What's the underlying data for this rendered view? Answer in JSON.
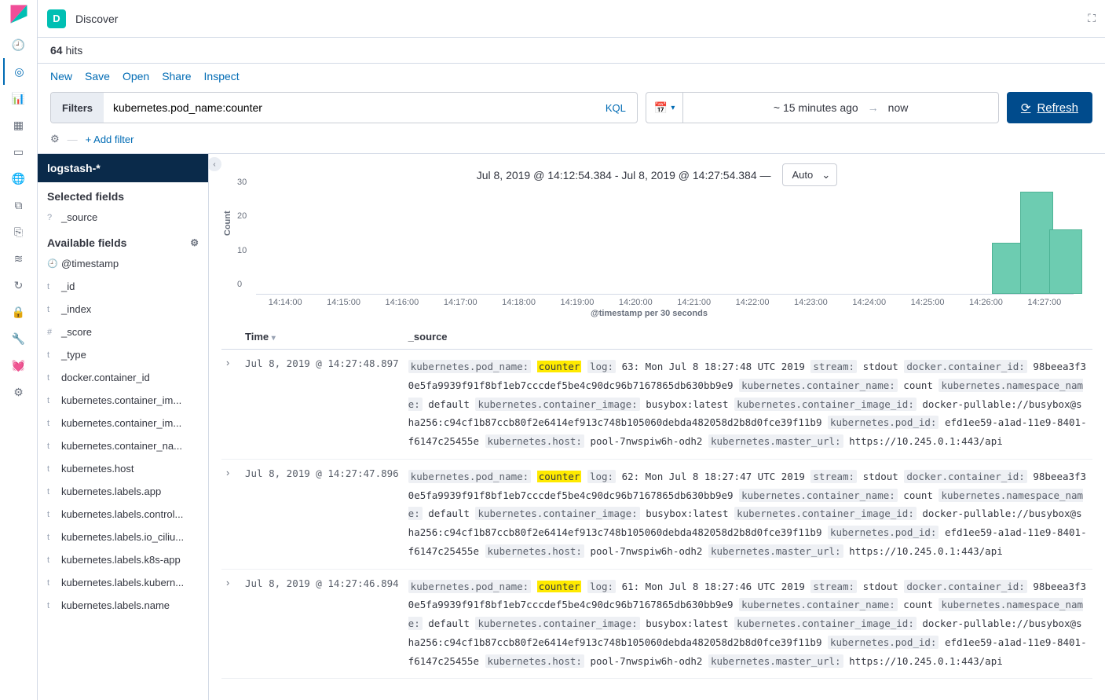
{
  "app": {
    "badge_letter": "D",
    "title": "Discover"
  },
  "hits": {
    "count": "64",
    "label": "hits"
  },
  "actions": {
    "new": "New",
    "save": "Save",
    "open": "Open",
    "share": "Share",
    "inspect": "Inspect"
  },
  "query": {
    "filters_label": "Filters",
    "value": "kubernetes.pod_name:counter",
    "lang": "KQL"
  },
  "time_picker": {
    "from": "~ 15 minutes ago",
    "arrow": "→",
    "to": "now"
  },
  "refresh_label": "Refresh",
  "add_filter": "+ Add filter",
  "index_pattern": "logstash-*",
  "fields": {
    "selected_label": "Selected fields",
    "available_label": "Available fields",
    "selected": [
      {
        "type": "?",
        "name": "_source"
      }
    ],
    "available": [
      {
        "type": "🕘",
        "name": "@timestamp"
      },
      {
        "type": "t",
        "name": "_id"
      },
      {
        "type": "t",
        "name": "_index"
      },
      {
        "type": "#",
        "name": "_score"
      },
      {
        "type": "t",
        "name": "_type"
      },
      {
        "type": "t",
        "name": "docker.container_id"
      },
      {
        "type": "t",
        "name": "kubernetes.container_im..."
      },
      {
        "type": "t",
        "name": "kubernetes.container_im..."
      },
      {
        "type": "t",
        "name": "kubernetes.container_na..."
      },
      {
        "type": "t",
        "name": "kubernetes.host"
      },
      {
        "type": "t",
        "name": "kubernetes.labels.app"
      },
      {
        "type": "t",
        "name": "kubernetes.labels.control..."
      },
      {
        "type": "t",
        "name": "kubernetes.labels.io_ciliu..."
      },
      {
        "type": "t",
        "name": "kubernetes.labels.k8s-app"
      },
      {
        "type": "t",
        "name": "kubernetes.labels.kubern..."
      },
      {
        "type": "t",
        "name": "kubernetes.labels.name"
      }
    ]
  },
  "chart_header": {
    "range": "Jul 8, 2019 @ 14:12:54.384 - Jul 8, 2019 @ 14:27:54.384",
    "dash": "—",
    "interval": "Auto"
  },
  "chart_data": {
    "type": "bar",
    "ylabel": "Count",
    "xlabel": "@timestamp per 30 seconds",
    "ylim": [
      0,
      30
    ],
    "yticks": [
      0,
      10,
      20,
      30
    ],
    "xticks": [
      "14:14:00",
      "14:15:00",
      "14:16:00",
      "14:17:00",
      "14:18:00",
      "14:19:00",
      "14:20:00",
      "14:21:00",
      "14:22:00",
      "14:23:00",
      "14:24:00",
      "14:25:00",
      "14:26:00",
      "14:27:00"
    ],
    "categories": [
      "14:26:30",
      "14:27:00",
      "14:27:30"
    ],
    "values": [
      15,
      30,
      19
    ],
    "bar_positions_pct": [
      90.0,
      93.5,
      97.0
    ]
  },
  "table": {
    "col_time": "Time",
    "col_source": "_source",
    "rows": [
      {
        "time": "Jul 8, 2019 @ 14:27:48.897",
        "kv": [
          {
            "k": "kubernetes.pod_name:",
            "v": "counter",
            "hl": true
          },
          {
            "k": "log:",
            "v": "63: Mon Jul 8 18:27:48 UTC 2019"
          },
          {
            "k": "stream:",
            "v": "stdout"
          },
          {
            "k": "docker.container_id:",
            "v": "98beea3f30e5fa9939f91f8bf1eb7cccdef5be4c90dc96b7167865db630bb9e9"
          },
          {
            "k": "kubernetes.container_name:",
            "v": "count"
          },
          {
            "k": "kubernetes.namespace_name:",
            "v": "default"
          },
          {
            "k": "kubernetes.container_image:",
            "v": "busybox:latest"
          },
          {
            "k": "kubernetes.container_image_id:",
            "v": "docker-pullable://busybox@sha256:c94cf1b87ccb80f2e6414ef913c748b105060debda482058d2b8d0fce39f11b9"
          },
          {
            "k": "kubernetes.pod_id:",
            "v": "efd1ee59-a1ad-11e9-8401-f6147c25455e"
          },
          {
            "k": "kubernetes.host:",
            "v": "pool-7nwspiw6h-odh2"
          },
          {
            "k": "kubernetes.master_url:",
            "v": "https://10.245.0.1:443/api"
          }
        ]
      },
      {
        "time": "Jul 8, 2019 @ 14:27:47.896",
        "kv": [
          {
            "k": "kubernetes.pod_name:",
            "v": "counter",
            "hl": true
          },
          {
            "k": "log:",
            "v": "62: Mon Jul 8 18:27:47 UTC 2019"
          },
          {
            "k": "stream:",
            "v": "stdout"
          },
          {
            "k": "docker.container_id:",
            "v": "98beea3f30e5fa9939f91f8bf1eb7cccdef5be4c90dc96b7167865db630bb9e9"
          },
          {
            "k": "kubernetes.container_name:",
            "v": "count"
          },
          {
            "k": "kubernetes.namespace_name:",
            "v": "default"
          },
          {
            "k": "kubernetes.container_image:",
            "v": "busybox:latest"
          },
          {
            "k": "kubernetes.container_image_id:",
            "v": "docker-pullable://busybox@sha256:c94cf1b87ccb80f2e6414ef913c748b105060debda482058d2b8d0fce39f11b9"
          },
          {
            "k": "kubernetes.pod_id:",
            "v": "efd1ee59-a1ad-11e9-8401-f6147c25455e"
          },
          {
            "k": "kubernetes.host:",
            "v": "pool-7nwspiw6h-odh2"
          },
          {
            "k": "kubernetes.master_url:",
            "v": "https://10.245.0.1:443/api"
          }
        ]
      },
      {
        "time": "Jul 8, 2019 @ 14:27:46.894",
        "kv": [
          {
            "k": "kubernetes.pod_name:",
            "v": "counter",
            "hl": true
          },
          {
            "k": "log:",
            "v": "61: Mon Jul 8 18:27:46 UTC 2019"
          },
          {
            "k": "stream:",
            "v": "stdout"
          },
          {
            "k": "docker.container_id:",
            "v": "98beea3f30e5fa9939f91f8bf1eb7cccdef5be4c90dc96b7167865db630bb9e9"
          },
          {
            "k": "kubernetes.container_name:",
            "v": "count"
          },
          {
            "k": "kubernetes.namespace_name:",
            "v": "default"
          },
          {
            "k": "kubernetes.container_image:",
            "v": "busybox:latest"
          },
          {
            "k": "kubernetes.container_image_id:",
            "v": "docker-pullable://busybox@sha256:c94cf1b87ccb80f2e6414ef913c748b105060debda482058d2b8d0fce39f11b9"
          },
          {
            "k": "kubernetes.pod_id:",
            "v": "efd1ee59-a1ad-11e9-8401-f6147c25455e"
          },
          {
            "k": "kubernetes.host:",
            "v": "pool-7nwspiw6h-odh2"
          },
          {
            "k": "kubernetes.master_url:",
            "v": "https://10.245.0.1:443/api"
          }
        ]
      }
    ]
  }
}
